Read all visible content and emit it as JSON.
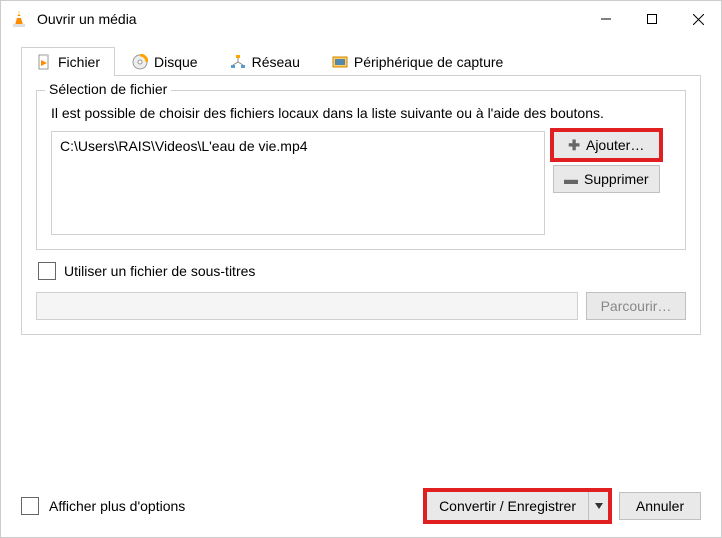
{
  "window": {
    "title": "Ouvrir un média"
  },
  "tabs": {
    "file": "Fichier",
    "disc": "Disque",
    "network": "Réseau",
    "capture": "Périphérique de capture"
  },
  "file_selection": {
    "group_title": "Sélection de fichier",
    "hint": "Il est possible de choisir des fichiers locaux dans la liste suivante ou à l'aide des boutons.",
    "selected_file": "C:\\Users\\RAIS\\Videos\\L'eau de vie.mp4",
    "add_button": "Ajouter…",
    "remove_button": "Supprimer"
  },
  "subtitles": {
    "checkbox_label": "Utiliser un fichier de sous-titres",
    "browse_button": "Parcourir…"
  },
  "footer": {
    "show_more": "Afficher plus d'options",
    "convert_save": "Convertir / Enregistrer",
    "cancel": "Annuler"
  }
}
